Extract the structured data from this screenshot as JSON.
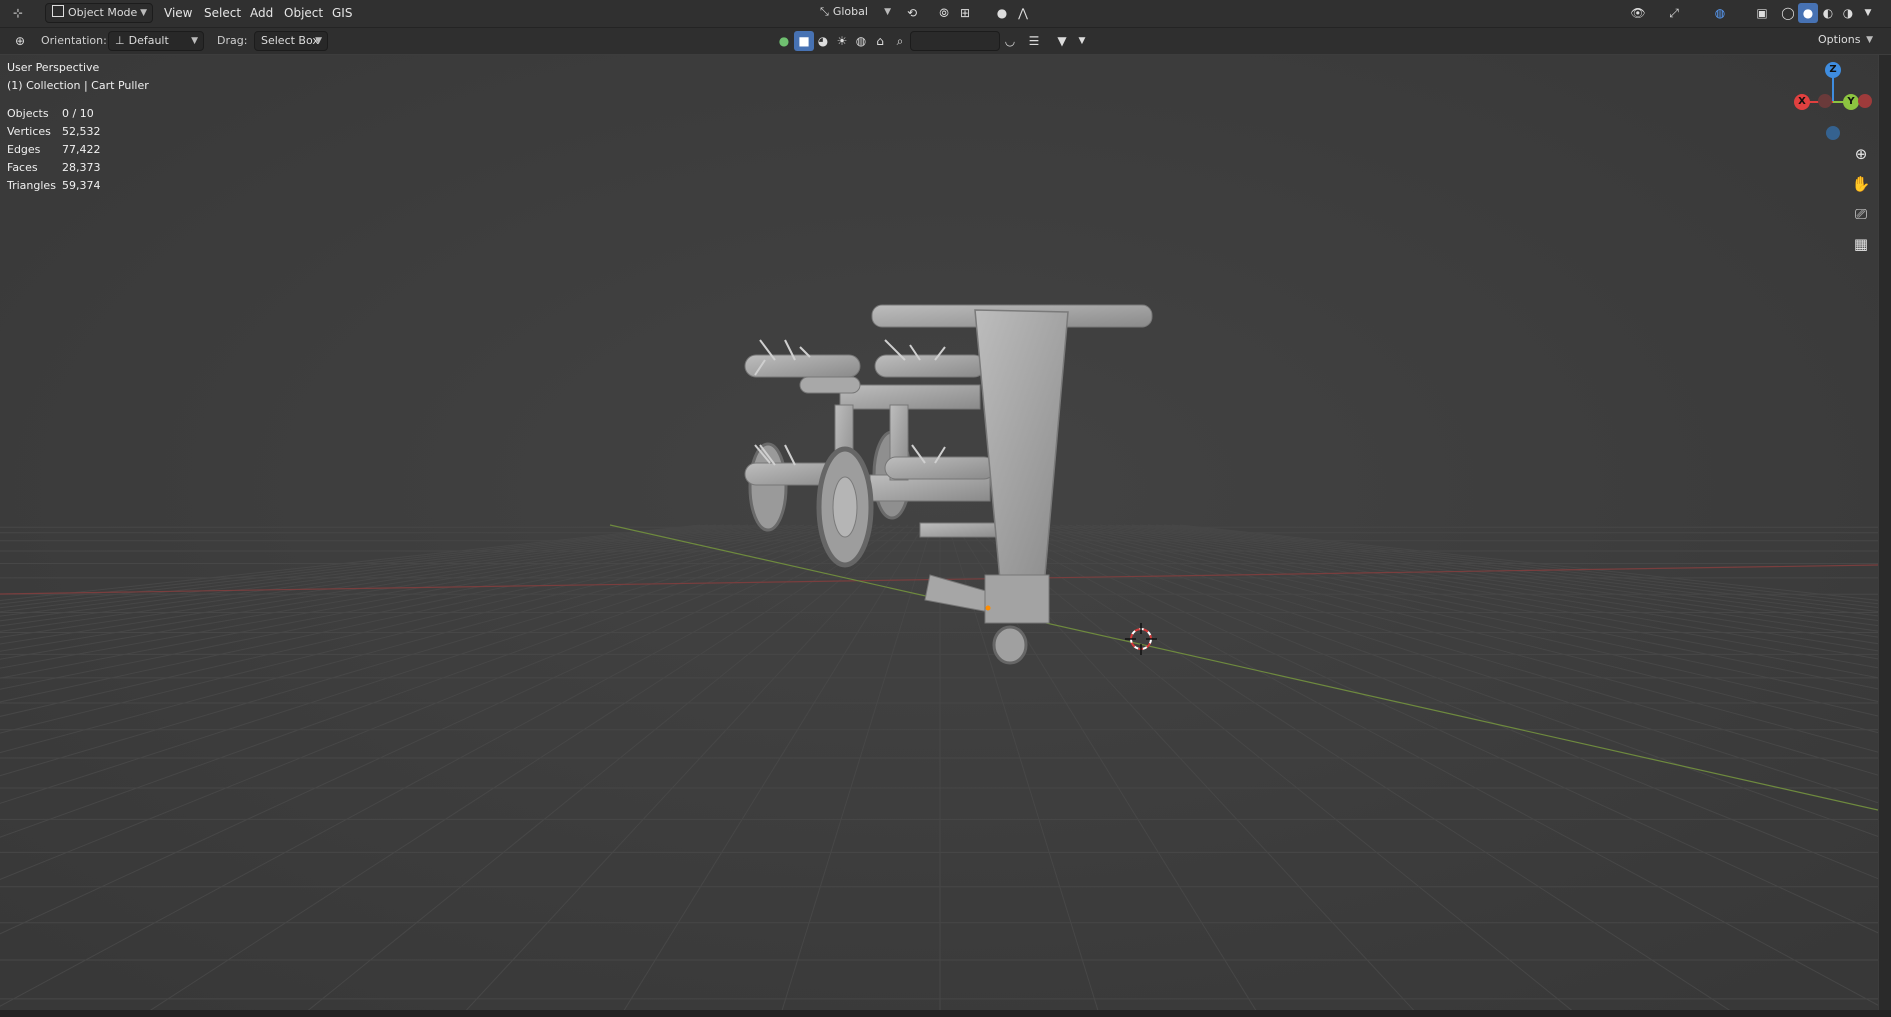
{
  "header": {
    "mode": "Object Mode",
    "menus": [
      "View",
      "Select",
      "Add",
      "Object",
      "GIS"
    ],
    "transform_orientation": "Global",
    "options_label": "Options"
  },
  "tool_settings": {
    "orientation_label": "Orientation:",
    "orientation_value": "Default",
    "drag_label": "Drag:",
    "drag_value": "Select Box"
  },
  "viewport": {
    "view_name": "User Perspective",
    "collection": "(1) Collection | Cart Puller",
    "stats": [
      {
        "key": "Objects",
        "value": "0 / 10"
      },
      {
        "key": "Vertices",
        "value": "52,532"
      },
      {
        "key": "Edges",
        "value": "77,422"
      },
      {
        "key": "Faces",
        "value": "28,373"
      },
      {
        "key": "Triangles",
        "value": "59,374"
      }
    ]
  },
  "gizmo": {
    "z": "Z",
    "x": "X",
    "y": "Y"
  },
  "colors": {
    "x_axis": "#e0403f",
    "y_axis": "#8cc440",
    "z_axis": "#3f8de0",
    "active": "#4772b3"
  }
}
